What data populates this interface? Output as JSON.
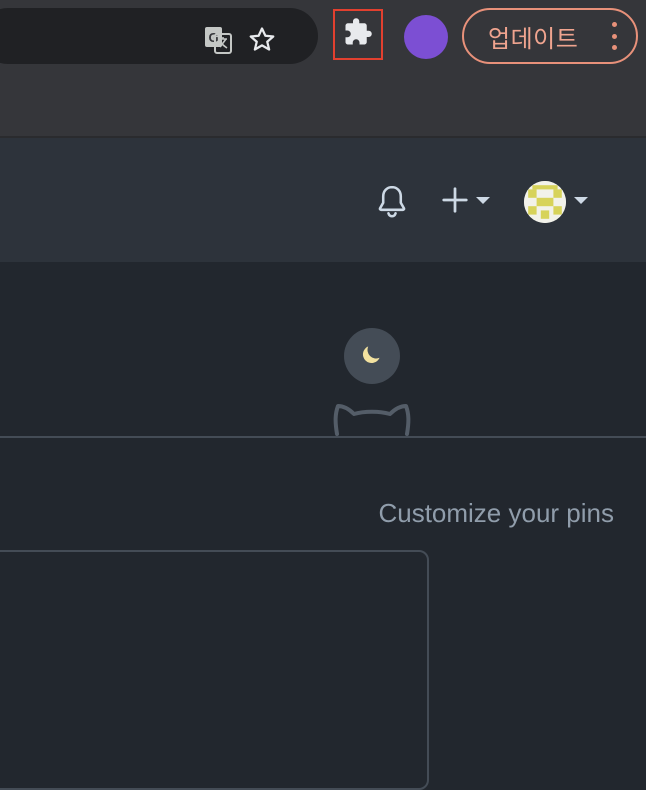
{
  "browser": {
    "update_label": "업데이트",
    "icons": {
      "translate": "translate-icon",
      "bookmark": "star-icon",
      "extensions": "puzzle-icon",
      "menu": "more-vert-icon"
    },
    "profile_color": "#7c4fd3",
    "highlight_color": "#e2402f"
  },
  "github_header": {
    "icons": [
      "bell-icon",
      "plus-icon",
      "caret-down-icon",
      "avatar"
    ]
  },
  "main": {
    "pins_heading": "Customize your pins"
  }
}
